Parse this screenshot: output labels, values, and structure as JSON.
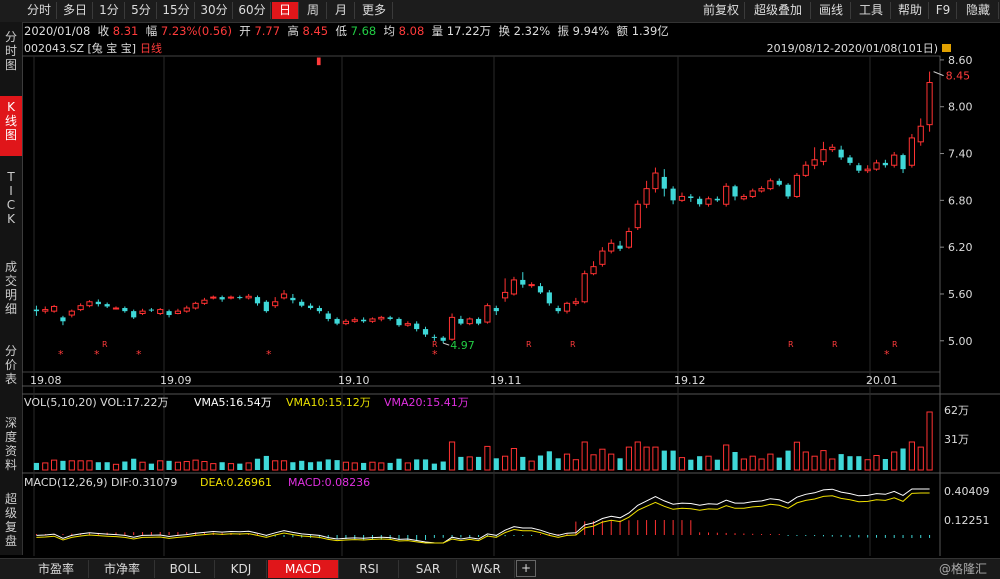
{
  "toolbar": {
    "periods": [
      "分时",
      "多日",
      "1分",
      "5分",
      "15分",
      "30分",
      "60分",
      "日",
      "周",
      "月",
      "更多"
    ],
    "active_period": "日",
    "right_items": [
      "前复权",
      "超级叠加",
      "画线",
      "工具",
      "帮助",
      "F9",
      "隐藏"
    ]
  },
  "sidebar": [
    "分时图",
    "K线图",
    "TICK",
    "成交明细",
    "分价表",
    "深度资料",
    "超级复盘"
  ],
  "sidebar_active": "K线图",
  "quote": {
    "date": "2020/01/08",
    "close_label": "收",
    "close": "8.31",
    "change_label": "幅",
    "change": "7.23%(0.56)",
    "open_label": "开",
    "open": "7.77",
    "high_label": "高",
    "high": "8.45",
    "low_label": "低",
    "low": "7.68",
    "avg_label": "均",
    "avg": "8.08",
    "vol_label": "量",
    "vol": "17.22万",
    "turnover_label": "换",
    "turnover": "2.32%",
    "amp_label": "振",
    "amp": "9.94%",
    "amount_label": "额",
    "amount": "1.39亿"
  },
  "symbol": "002043.SZ [兔 宝 宝]",
  "period_label": "日线",
  "range": "2019/08/12-2020/01/08(101日)",
  "colors": {
    "up": "#ff3232",
    "down": "#3fd8d8",
    "vol_ma5": "#ffffff",
    "vol_ma10": "#e8e000",
    "vol_ma20": "#e030e0"
  },
  "chart_data": {
    "type": "candlestick",
    "y_ticks": [
      "8.60",
      "8.00",
      "7.40",
      "6.80",
      "6.20",
      "5.60",
      "5.00"
    ],
    "ylim": [
      4.6,
      8.65
    ],
    "x_ticks": [
      "19.08",
      "19.09",
      "19.10",
      "19.11",
      "19.12",
      "20.01"
    ],
    "high_marker": "8.45",
    "low_marker": "4.97",
    "candles": [
      [
        5.4,
        5.38,
        5.45,
        5.32
      ],
      [
        5.38,
        5.4,
        5.44,
        5.35
      ],
      [
        5.38,
        5.44,
        5.46,
        5.36
      ],
      [
        5.3,
        5.25,
        5.32,
        5.2
      ],
      [
        5.33,
        5.38,
        5.4,
        5.3
      ],
      [
        5.4,
        5.45,
        5.48,
        5.38
      ],
      [
        5.45,
        5.5,
        5.52,
        5.43
      ],
      [
        5.5,
        5.47,
        5.53,
        5.44
      ],
      [
        5.47,
        5.44,
        5.49,
        5.42
      ],
      [
        5.42,
        5.42,
        5.44,
        5.4
      ],
      [
        5.42,
        5.38,
        5.44,
        5.36
      ],
      [
        5.38,
        5.3,
        5.4,
        5.28
      ],
      [
        5.35,
        5.38,
        5.41,
        5.33
      ],
      [
        5.4,
        5.39,
        5.42,
        5.37
      ],
      [
        5.35,
        5.4,
        5.42,
        5.33
      ],
      [
        5.38,
        5.33,
        5.4,
        5.3
      ],
      [
        5.35,
        5.38,
        5.41,
        5.34
      ],
      [
        5.38,
        5.42,
        5.45,
        5.36
      ],
      [
        5.42,
        5.48,
        5.5,
        5.4
      ],
      [
        5.48,
        5.52,
        5.55,
        5.46
      ],
      [
        5.55,
        5.56,
        5.58,
        5.53
      ],
      [
        5.56,
        5.53,
        5.58,
        5.5
      ],
      [
        5.55,
        5.56,
        5.58,
        5.53
      ],
      [
        5.56,
        5.55,
        5.58,
        5.53
      ],
      [
        5.55,
        5.57,
        5.6,
        5.53
      ],
      [
        5.56,
        5.48,
        5.58,
        5.45
      ],
      [
        5.5,
        5.38,
        5.52,
        5.36
      ],
      [
        5.45,
        5.5,
        5.56,
        5.42
      ],
      [
        5.55,
        5.6,
        5.65,
        5.53
      ],
      [
        5.55,
        5.52,
        5.6,
        5.48
      ],
      [
        5.5,
        5.45,
        5.53,
        5.43
      ],
      [
        5.45,
        5.42,
        5.48,
        5.4
      ],
      [
        5.42,
        5.38,
        5.45,
        5.35
      ],
      [
        5.35,
        5.28,
        5.38,
        5.25
      ],
      [
        5.28,
        5.22,
        5.3,
        5.2
      ],
      [
        5.22,
        5.25,
        5.28,
        5.2
      ],
      [
        5.25,
        5.27,
        5.3,
        5.23
      ],
      [
        5.27,
        5.25,
        5.3,
        5.23
      ],
      [
        5.25,
        5.28,
        5.3,
        5.23
      ],
      [
        5.28,
        5.3,
        5.32,
        5.25
      ],
      [
        5.3,
        5.28,
        5.32,
        5.26
      ],
      [
        5.28,
        5.2,
        5.3,
        5.18
      ],
      [
        5.2,
        5.22,
        5.25,
        5.18
      ],
      [
        5.22,
        5.15,
        5.25,
        5.12
      ],
      [
        5.15,
        5.08,
        5.18,
        5.05
      ],
      [
        5.05,
        5.04,
        5.08,
        5.0
      ],
      [
        5.04,
        5.0,
        5.06,
        4.97
      ],
      [
        5.02,
        5.3,
        5.35,
        5.0
      ],
      [
        5.28,
        5.22,
        5.32,
        5.2
      ],
      [
        5.22,
        5.28,
        5.3,
        5.2
      ],
      [
        5.28,
        5.22,
        5.3,
        5.2
      ],
      [
        5.24,
        5.45,
        5.48,
        5.22
      ],
      [
        5.42,
        5.38,
        5.45,
        5.33
      ],
      [
        5.55,
        5.62,
        5.8,
        5.5
      ],
      [
        5.6,
        5.78,
        5.82,
        5.58
      ],
      [
        5.78,
        5.72,
        5.88,
        5.68
      ],
      [
        5.72,
        5.72,
        5.75,
        5.68
      ],
      [
        5.7,
        5.62,
        5.74,
        5.6
      ],
      [
        5.62,
        5.48,
        5.65,
        5.45
      ],
      [
        5.42,
        5.38,
        5.45,
        5.35
      ],
      [
        5.38,
        5.48,
        5.5,
        5.35
      ],
      [
        5.48,
        5.5,
        5.55,
        5.45
      ],
      [
        5.5,
        5.86,
        5.9,
        5.48
      ],
      [
        5.86,
        5.95,
        6.02,
        5.84
      ],
      [
        5.98,
        6.15,
        6.2,
        5.95
      ],
      [
        6.15,
        6.25,
        6.3,
        6.12
      ],
      [
        6.22,
        6.18,
        6.28,
        6.15
      ],
      [
        6.2,
        6.4,
        6.45,
        6.18
      ],
      [
        6.45,
        6.75,
        6.8,
        6.42
      ],
      [
        6.75,
        6.95,
        7.05,
        6.7
      ],
      [
        6.95,
        7.15,
        7.22,
        6.9
      ],
      [
        7.1,
        6.95,
        7.2,
        6.85
      ],
      [
        6.95,
        6.8,
        6.98,
        6.75
      ],
      [
        6.8,
        6.85,
        6.9,
        6.78
      ],
      [
        6.85,
        6.83,
        6.88,
        6.78
      ],
      [
        6.82,
        6.75,
        6.85,
        6.72
      ],
      [
        6.75,
        6.82,
        6.85,
        6.72
      ],
      [
        6.82,
        6.8,
        6.85,
        6.78
      ],
      [
        6.75,
        6.98,
        7.02,
        6.72
      ],
      [
        6.98,
        6.85,
        7.0,
        6.8
      ],
      [
        6.82,
        6.85,
        6.88,
        6.8
      ],
      [
        6.85,
        6.92,
        6.95,
        6.83
      ],
      [
        6.92,
        6.95,
        6.98,
        6.9
      ],
      [
        6.95,
        7.05,
        7.08,
        6.93
      ],
      [
        7.05,
        7.0,
        7.08,
        6.98
      ],
      [
        7.0,
        6.85,
        7.02,
        6.82
      ],
      [
        6.85,
        7.12,
        7.15,
        6.83
      ],
      [
        7.12,
        7.25,
        7.3,
        7.1
      ],
      [
        7.25,
        7.32,
        7.48,
        7.2
      ],
      [
        7.3,
        7.45,
        7.55,
        7.25
      ],
      [
        7.45,
        7.48,
        7.52,
        7.42
      ],
      [
        7.45,
        7.35,
        7.5,
        7.32
      ],
      [
        7.35,
        7.28,
        7.38,
        7.25
      ],
      [
        7.25,
        7.18,
        7.28,
        7.15
      ],
      [
        7.18,
        7.2,
        7.25,
        7.15
      ],
      [
        7.2,
        7.28,
        7.32,
        7.18
      ],
      [
        7.28,
        7.25,
        7.32,
        7.22
      ],
      [
        7.25,
        7.38,
        7.42,
        7.22
      ],
      [
        7.38,
        7.2,
        7.4,
        7.15
      ],
      [
        7.25,
        7.6,
        7.65,
        7.22
      ],
      [
        7.55,
        7.75,
        7.85,
        7.5
      ],
      [
        7.77,
        8.31,
        8.45,
        7.68
      ]
    ],
    "volume_title": "VOL(5,10,20) VOL:17.22万",
    "volume_ma5": "VMA5:16.54万",
    "volume_ma10": "VMA10:15.12万",
    "volume_ma20": "VMA20:15.41万",
    "volume_ticks": [
      "62万",
      "31万"
    ],
    "macd_title": "MACD(12,26,9) DIF:0.31079",
    "macd_dea": "DEA:0.26961",
    "macd_value": "MACD:0.08236",
    "macd_ticks": [
      "0.40409",
      "0.12251"
    ]
  },
  "bottom_tabs": [
    "市盈率",
    "市净率",
    "BOLL",
    "KDJ",
    "MACD",
    "RSI",
    "SAR",
    "W&R"
  ],
  "bottom_active": "MACD",
  "watermark": "@格隆汇"
}
